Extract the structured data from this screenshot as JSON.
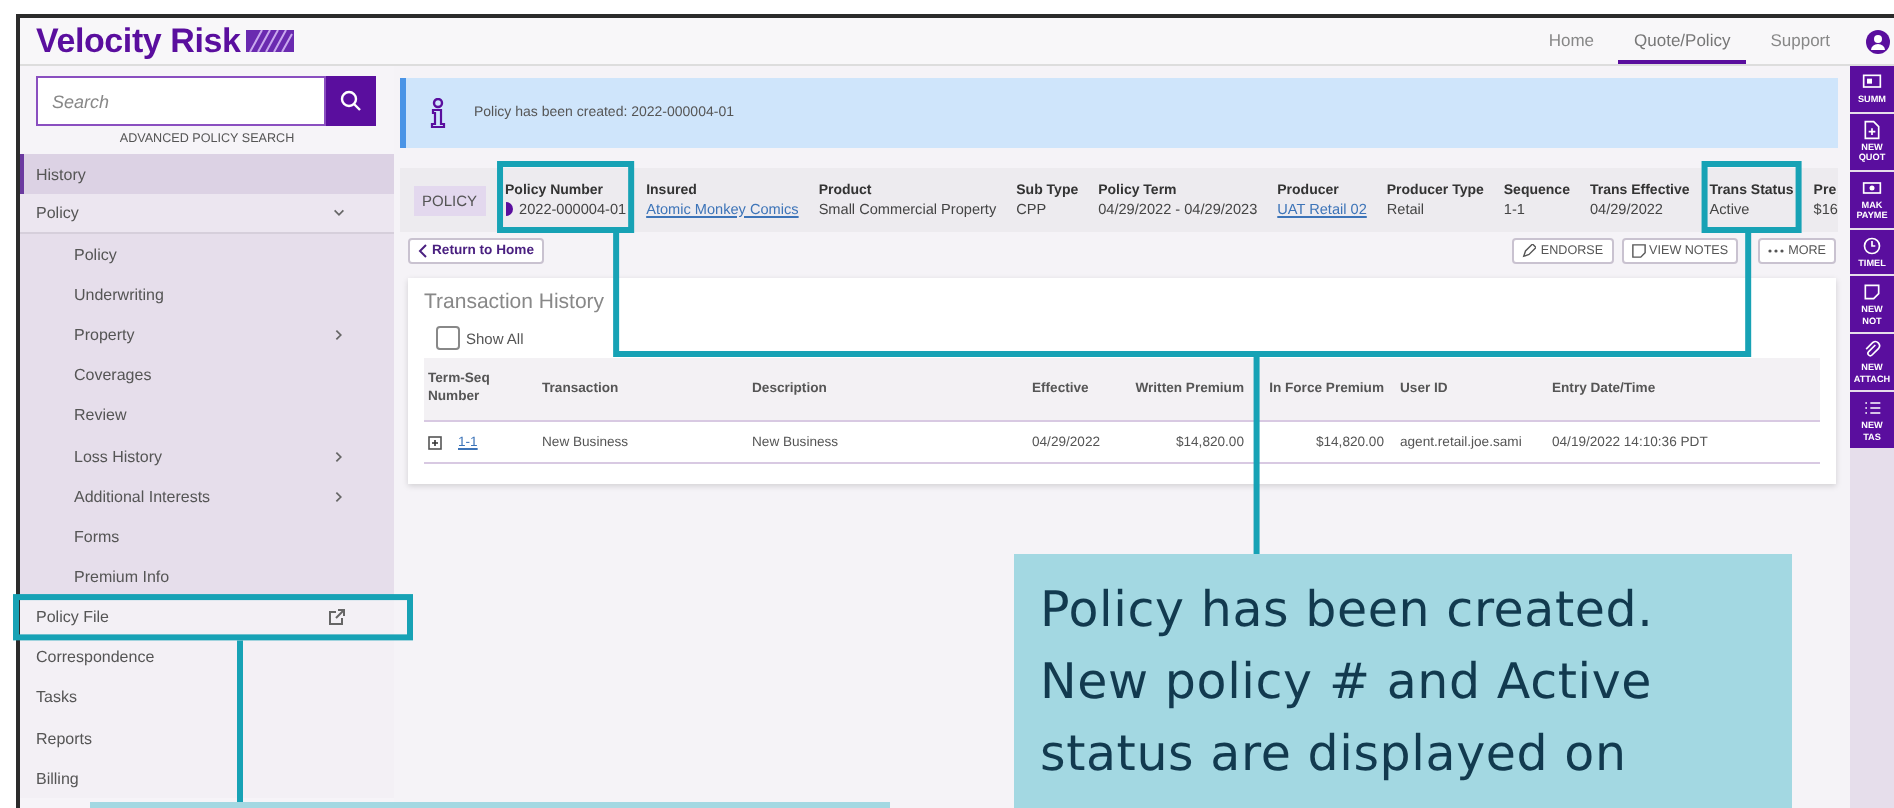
{
  "header": {
    "logo": "Velocity Risk",
    "nav": [
      {
        "label": "Home",
        "selected": false
      },
      {
        "label": "Quote/Policy",
        "selected": true
      },
      {
        "label": "Support",
        "selected": false
      }
    ]
  },
  "sidebar": {
    "search": {
      "placeholder": "Search"
    },
    "advanced_link": "ADVANCED POLICY SEARCH",
    "items": [
      {
        "label": "History",
        "kind": "plain",
        "selected": true
      },
      {
        "label": "Policy",
        "kind": "group",
        "selected": false,
        "expanded": true,
        "children": [
          {
            "label": "Policy",
            "kind": "plain"
          },
          {
            "label": "Underwriting",
            "kind": "plain"
          },
          {
            "label": "Property",
            "kind": "submenu"
          },
          {
            "label": "Coverages",
            "kind": "plain"
          },
          {
            "label": "Review",
            "kind": "plain"
          },
          {
            "label": "Loss History",
            "kind": "submenu"
          },
          {
            "label": "Additional Interests",
            "kind": "submenu"
          },
          {
            "label": "Forms",
            "kind": "plain"
          },
          {
            "label": "Premium Info",
            "kind": "plain"
          }
        ]
      },
      {
        "label": "Policy File",
        "kind": "external",
        "selected": false
      },
      {
        "label": "Correspondence",
        "kind": "plain",
        "selected": false
      },
      {
        "label": "Tasks",
        "kind": "plain",
        "selected": false
      },
      {
        "label": "Reports",
        "kind": "plain",
        "selected": false
      },
      {
        "label": "Billing",
        "kind": "plain",
        "selected": false
      }
    ]
  },
  "banner": {
    "message": "Policy has been created: 2022-000004-01"
  },
  "info_bar": {
    "tag": "POLICY",
    "fields": [
      {
        "label": "Policy Number",
        "value": "2022-000004-01",
        "kind": "text"
      },
      {
        "label": "Insured",
        "value": "Atomic Monkey Comics",
        "kind": "link"
      },
      {
        "label": "Product",
        "value": "Small Commercial Property",
        "kind": "text"
      },
      {
        "label": "Sub Type",
        "value": "CPP",
        "kind": "text"
      },
      {
        "label": "Policy Term",
        "value": "04/29/2022 - 04/29/2023",
        "kind": "text"
      },
      {
        "label": "Producer",
        "value": "UAT Retail 02",
        "kind": "link"
      },
      {
        "label": "Producer Type",
        "value": "Retail",
        "kind": "text"
      },
      {
        "label": "Sequence",
        "value": "1-1",
        "kind": "text"
      },
      {
        "label": "Trans Effective",
        "value": "04/29/2022",
        "kind": "text"
      },
      {
        "label": "Trans Status",
        "value": "Active",
        "kind": "text"
      },
      {
        "label": "Pre",
        "value": "$16",
        "kind": "text"
      }
    ]
  },
  "actions": {
    "back": "Return to Home",
    "buttons": [
      {
        "label": "ENDORSE",
        "kind": "edit"
      },
      {
        "label": "VIEW NOTES",
        "kind": "notes"
      },
      {
        "label": "MORE",
        "kind": "more"
      }
    ]
  },
  "transactions": {
    "title": "Transaction History",
    "show_all": {
      "label": "Show All",
      "checked": false
    },
    "columns": [
      "Term-Seq Number",
      "Transaction",
      "Description",
      "Effective",
      "Written Premium",
      "In Force Premium",
      "User ID",
      "Entry Date/Time"
    ],
    "rows": [
      {
        "expanded": false,
        "cells": [
          "1-1",
          "New Business",
          "New Business",
          "04/29/2022",
          "$14,820.00",
          "$14,820.00",
          "agent.retail.joe.sami",
          "04/19/2022 14:10:36 PDT"
        ]
      }
    ]
  },
  "right_rail": [
    {
      "label": "SUMM",
      "kind": "summary"
    },
    {
      "label": "NEW\nQUOT",
      "kind": "quote"
    },
    {
      "label": "MAK\nPAYME",
      "kind": "payment"
    },
    {
      "label": "TIMEL",
      "kind": "timeline"
    },
    {
      "label": "NEW\nNOT",
      "kind": "note"
    },
    {
      "label": "NEW\nATTACH",
      "kind": "attachment"
    },
    {
      "label": "NEW\nTAS",
      "kind": "task"
    }
  ],
  "callout": {
    "text": "Policy has been created. New policy # and Active status are displayed on"
  }
}
